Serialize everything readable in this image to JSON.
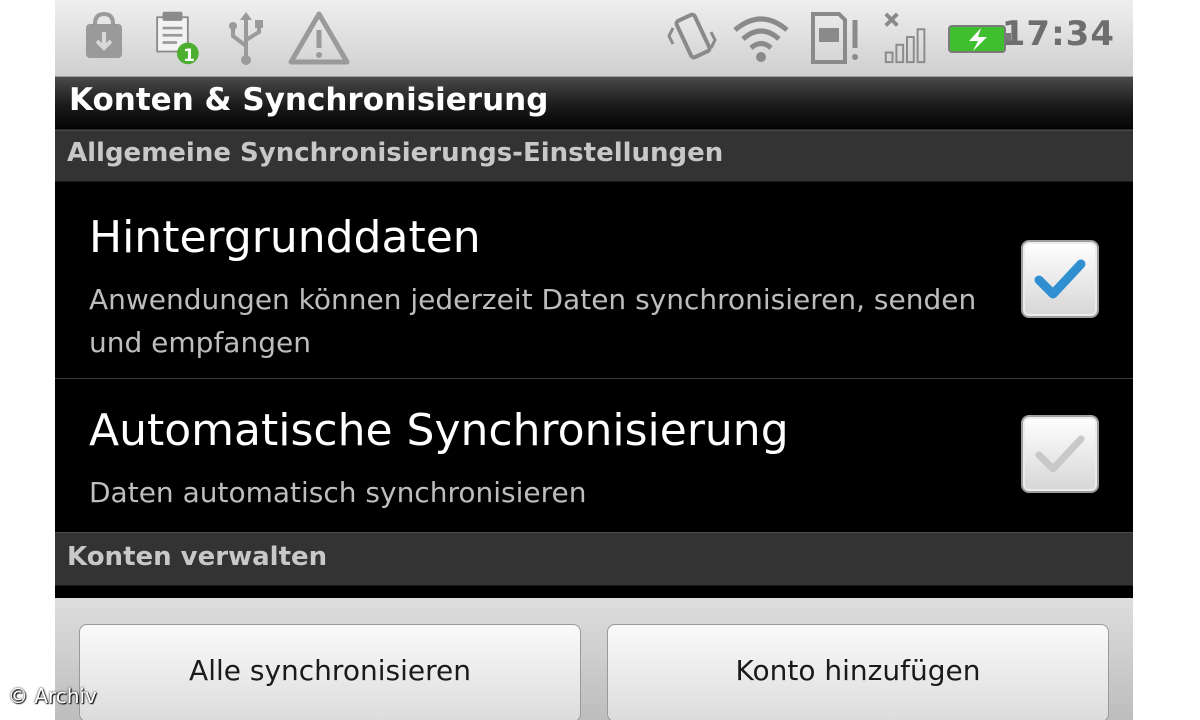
{
  "status_bar": {
    "time": "17:34",
    "icons": [
      "shopping-bag-icon",
      "notification-clip-icon",
      "usb-icon",
      "warning-icon",
      "vibrate-icon",
      "wifi-icon",
      "sd-card-warning-icon",
      "signal-no-service-icon",
      "battery-charging-icon"
    ],
    "notification_badge": "1"
  },
  "title_bar": {
    "title": "Konten & Synchronisierung"
  },
  "sections": {
    "general_header": "Allgemeine Synchronisierungs-Einstellungen",
    "manage_header": "Konten verwalten"
  },
  "preferences": {
    "background_data": {
      "title": "Hintergrunddaten",
      "summary": "Anwendungen können jederzeit Daten synchronisieren, senden und empfangen",
      "checked": true
    },
    "auto_sync": {
      "title": "Automatische Synchronisierung",
      "summary": "Daten automatisch synchronisieren",
      "checked": false
    }
  },
  "buttons": {
    "sync_all": "Alle synchronisieren",
    "add_account": "Konto hinzufügen"
  },
  "watermark": "© Archiv",
  "colors": {
    "check_active": "#2f8fd0",
    "check_inactive": "#c8c8c8",
    "battery": "#3fbf2f",
    "badge": "#4caf2f"
  }
}
